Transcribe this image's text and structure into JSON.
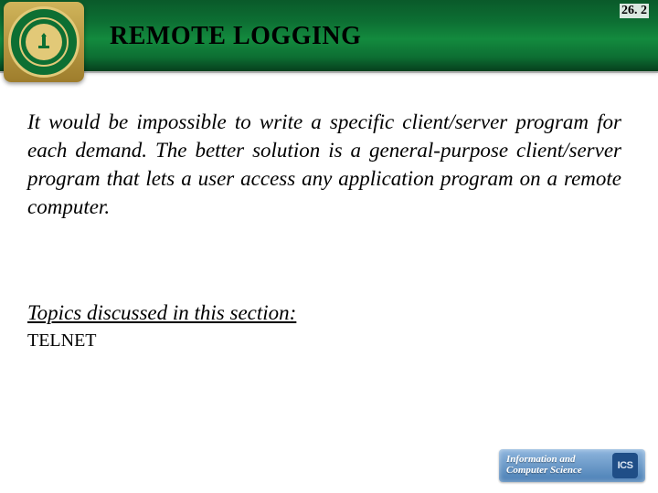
{
  "page_number": "26. 2",
  "title": "REMOTE LOGGING",
  "body": "It would be impossible to write a specific client/server program for each demand. The better solution is a general-purpose client/server program that lets a user access any application program on a remote computer.",
  "topics_heading": "Topics discussed in this section:",
  "topics": {
    "item1": "TELNET"
  },
  "footer": {
    "line1": "Information and",
    "line2": "Computer Science",
    "badge": "ICS"
  }
}
